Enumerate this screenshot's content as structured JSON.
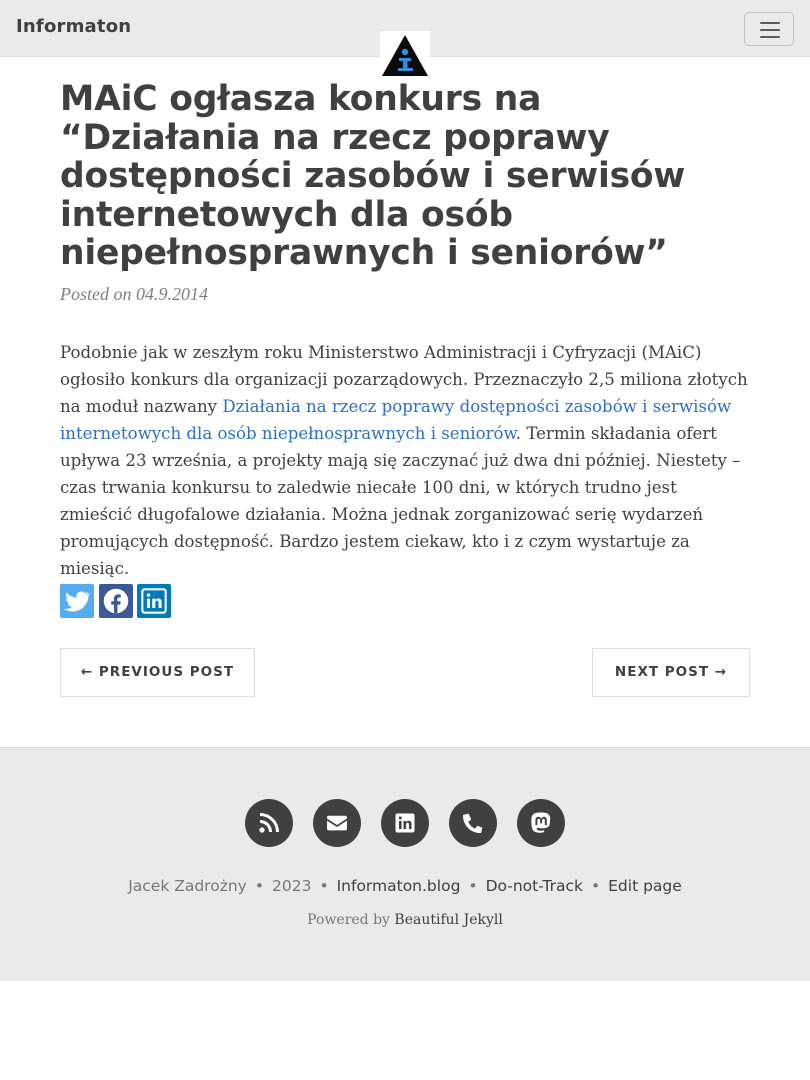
{
  "navbar": {
    "brand": "Informaton"
  },
  "post": {
    "title": "MAiC ogłasza konkurs na “Działania na rzecz poprawy dostępności zasobów i serwisów internetowych dla osób niepełnosprawnych i seniorów”",
    "meta_prefix": "Posted on ",
    "date": "04.9.2014",
    "body_before": "Podobnie jak w zeszłym roku Ministerstwo Administracji i Cyfryzacji (MAiC) ogłosiło konkurs dla organizacji pozarządowych. Przeznaczyło 2,5 miliona złotych na moduł nazwany ",
    "body_link": "Działania na rzecz poprawy dostępności zasobów i serwisów internetowych dla osób niepełnosprawnych i seniorów",
    "body_after": ". Termin składania ofert upływa 23 września, a projekty mają się zaczynać już dwa dni później. Niestety – czas trwania konkursu to zaledwie niecałe 100 dni, w których trudno jest zmieścić długofalowe działania. Można jednak zorganizować serię wydarzeń promujących dostępność. Bardzo jestem ciekaw, kto i z czym wystartuje za miesiąc."
  },
  "share": {
    "icons": [
      "twitter-icon",
      "facebook-icon",
      "linkedin-icon"
    ],
    "colors": {
      "twitter": "#55acee",
      "facebook": "#3b5998",
      "linkedin": "#007bb5"
    }
  },
  "pager": {
    "previous": "← PREVIOUS POST",
    "next": "NEXT POST →"
  },
  "footer": {
    "icons": [
      "rss-icon",
      "envelope-icon",
      "linkedin-icon",
      "phone-icon",
      "mastodon-icon"
    ],
    "author": "Jacek Zadrożny",
    "year": "2023",
    "site": "Informaton.blog",
    "dnt": "Do-not-Track",
    "edit": "Edit page",
    "powered_prefix": "Powered by ",
    "powered_link": "Beautiful Jekyll",
    "separator": "•"
  },
  "colors": {
    "navbar_bg": "#eaeaea",
    "text": "#404040",
    "link": "#2a6fc9",
    "footer_bg": "#eaeaea"
  }
}
